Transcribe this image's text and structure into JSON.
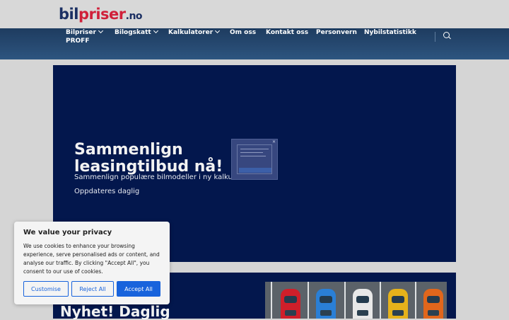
{
  "brand": {
    "part1": "bil",
    "part2": "priser",
    "part3": ".no"
  },
  "nav": {
    "items": [
      {
        "label": "Bilpriser",
        "dropdown": true
      },
      {
        "label": "Bilogskatt",
        "dropdown": true
      },
      {
        "label": "Kalkulatorer",
        "dropdown": true
      },
      {
        "label": "Om oss",
        "dropdown": false
      },
      {
        "label": "Kontakt oss",
        "dropdown": false
      },
      {
        "label": "Personvern",
        "dropdown": false
      },
      {
        "label": "Nybilstatistikk",
        "dropdown": false
      },
      {
        "label": "PROFF",
        "dropdown": false
      }
    ],
    "search_icon": "search-icon"
  },
  "hero": {
    "title": "Sammenlign leasingtilbud nå!",
    "subtitle": "Sammenlign populære bilmodeller i ny kalkulator",
    "updated": "Oppdateres daglig"
  },
  "section2": {
    "title": "Nyhet! Daglig"
  },
  "cookie": {
    "title": "We value your privacy",
    "text": "We use cookies to enhance your browsing experience, serve personalised ads or content, and analyse our traffic. By clicking \"Accept All\", you consent to our use of cookies.",
    "customise": "Customise",
    "reject": "Reject All",
    "accept": "Accept All"
  },
  "colors": {
    "brand_navy": "#1b2f63",
    "brand_red": "#d0203a",
    "nav_bg": "#274a72",
    "hero_bg": "#03174d",
    "accent_blue": "#1863dc"
  }
}
